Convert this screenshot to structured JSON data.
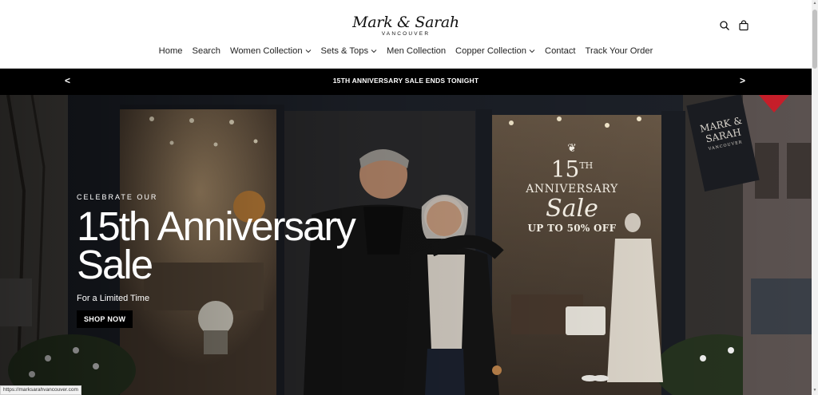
{
  "brand": {
    "name": "Mark & Sarah",
    "tagline": "VANCOUVER"
  },
  "header_icons": [
    "search-icon",
    "cart-icon"
  ],
  "nav": [
    {
      "label": "Home",
      "dropdown": false
    },
    {
      "label": "Search",
      "dropdown": false
    },
    {
      "label": "Women Collection",
      "dropdown": true
    },
    {
      "label": "Sets & Tops",
      "dropdown": true
    },
    {
      "label": "Men Collection",
      "dropdown": false
    },
    {
      "label": "Copper Collection",
      "dropdown": true
    },
    {
      "label": "Contact",
      "dropdown": false
    },
    {
      "label": "Track Your Order",
      "dropdown": false
    }
  ],
  "announcement": {
    "text": "15TH ANNIVERSARY SALE ENDS TONIGHT",
    "prev": "<",
    "next": ">"
  },
  "hero": {
    "eyebrow": "CELEBRATE OUR",
    "headline_line1": "15th Anniversary",
    "headline_line2": "Sale",
    "subline": "For a Limited Time",
    "cta": "SHOP NOW",
    "window_sign": {
      "line1": "15",
      "sup": "TH",
      "line2": "ANNIVERSARY",
      "line3": "Sale",
      "line4": "UP TO 50% OFF"
    },
    "shop_sign": {
      "line1": "MARK &",
      "line2": "SARAH",
      "line3": "VANCOUVER"
    }
  },
  "status_url": "https://marksarahvancouver.com",
  "colors": {
    "bar": "#000000",
    "text_light": "#ffffff",
    "accent_red": "#c81e2a"
  }
}
